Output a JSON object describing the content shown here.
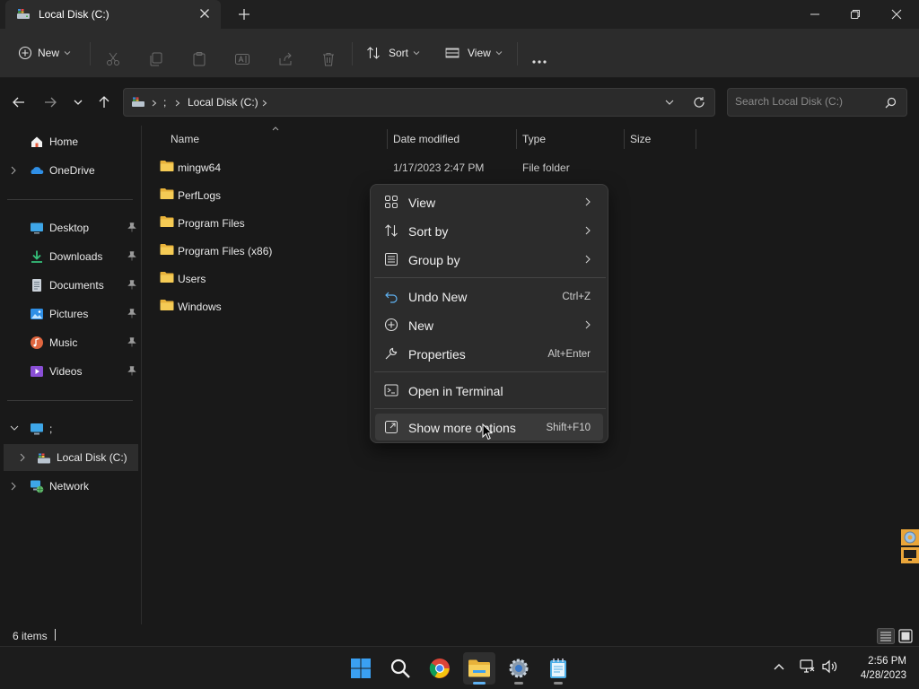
{
  "window": {
    "tab_title": "Local Disk (C:)",
    "icons": {
      "tab": "drive-icon",
      "close_tab": "close-icon",
      "new_tab": "plus-icon",
      "minimize": "minimize-icon",
      "maximize": "restore-icon",
      "close": "close-icon"
    }
  },
  "toolbar": {
    "new_label": "New",
    "sort_label": "Sort",
    "view_label": "View",
    "icons": [
      "cut-icon",
      "copy-icon",
      "paste-icon",
      "rename-icon",
      "share-icon",
      "delete-icon",
      "more-icon"
    ]
  },
  "address": {
    "crumbs": [
      ";",
      "Local Disk (C:)"
    ],
    "search_placeholder": "Search Local Disk (C:)"
  },
  "sidebar": {
    "items": [
      {
        "label": "Home",
        "icon": "home-icon"
      },
      {
        "label": "OneDrive",
        "icon": "onedrive-icon"
      },
      {
        "label": "Desktop",
        "icon": "desktop-icon",
        "pinned": true
      },
      {
        "label": "Downloads",
        "icon": "download-icon",
        "pinned": true
      },
      {
        "label": "Documents",
        "icon": "documents-icon",
        "pinned": true
      },
      {
        "label": "Pictures",
        "icon": "pictures-icon",
        "pinned": true
      },
      {
        "label": "Music",
        "icon": "music-icon",
        "pinned": true
      },
      {
        "label": "Videos",
        "icon": "videos-icon",
        "pinned": true
      },
      {
        "label": ";",
        "icon": "computer-icon"
      },
      {
        "label": "Local Disk (C:)",
        "icon": "drive-icon",
        "selected": true
      },
      {
        "label": "Network",
        "icon": "network-icon"
      }
    ]
  },
  "columns": {
    "name": "Name",
    "date": "Date modified",
    "type": "Type",
    "size": "Size"
  },
  "files": [
    {
      "name": "mingw64",
      "date": "1/17/2023 2:47 PM",
      "type": "File folder"
    },
    {
      "name": "PerfLogs",
      "date": "",
      "type": ""
    },
    {
      "name": "Program Files",
      "date": "",
      "type": ""
    },
    {
      "name": "Program Files (x86)",
      "date": "",
      "type": ""
    },
    {
      "name": "Users",
      "date": "",
      "type": ""
    },
    {
      "name": "Windows",
      "date": "",
      "type": ""
    }
  ],
  "context_menu": {
    "items": [
      {
        "label": "View",
        "icon": "grid-icon",
        "submenu": true
      },
      {
        "label": "Sort by",
        "icon": "sort-icon",
        "submenu": true
      },
      {
        "label": "Group by",
        "icon": "group-icon",
        "submenu": true
      },
      {
        "label": "Undo New",
        "icon": "undo-icon",
        "shortcut": "Ctrl+Z"
      },
      {
        "label": "New",
        "icon": "new-icon",
        "submenu": true
      },
      {
        "label": "Properties",
        "icon": "wrench-icon",
        "shortcut": "Alt+Enter"
      },
      {
        "label": "Open in Terminal",
        "icon": "terminal-icon"
      },
      {
        "label": "Show more options",
        "icon": "more-options-icon",
        "shortcut": "Shift+F10",
        "hovered": true
      }
    ]
  },
  "status": {
    "item_count": "6 items"
  },
  "taskbar": {
    "apps": [
      "windows-start-icon",
      "search-icon",
      "chrome-icon",
      "file-explorer-icon",
      "settings-icon",
      "notepad-icon"
    ],
    "active_app": "file-explorer-icon",
    "time": "2:56 PM",
    "date": "4/28/2023"
  },
  "colors": {
    "accent": "#5fb2f2",
    "folder": "#f3c440",
    "background": "#191919",
    "menu": "#2c2c2c"
  }
}
